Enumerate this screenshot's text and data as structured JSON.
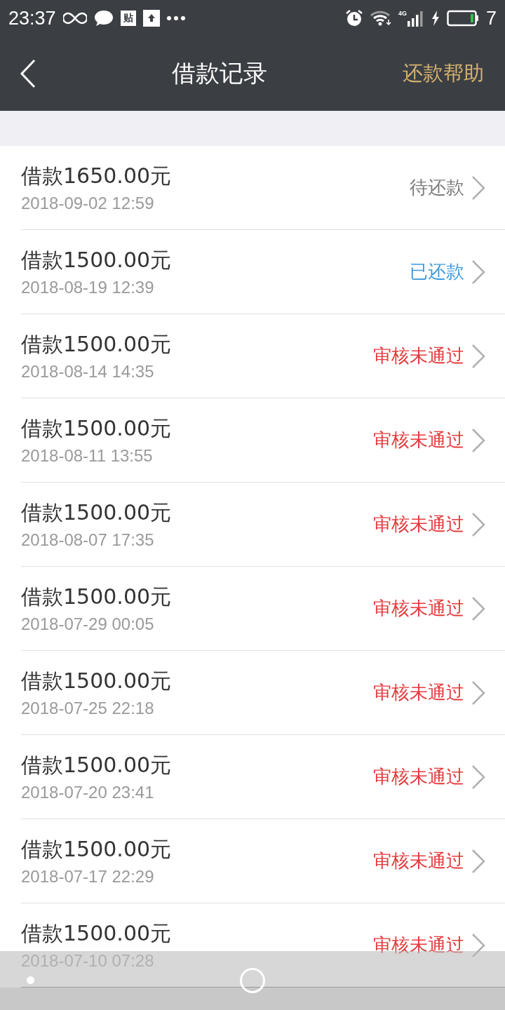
{
  "status_bar": {
    "time": "23:37",
    "notification_badge": "贴",
    "network": "4G",
    "battery": "7"
  },
  "header": {
    "title": "借款记录",
    "action": "还款帮助"
  },
  "records": [
    {
      "title": "借款1650.00元",
      "date": "2018-09-02 12:59",
      "status": "待还款",
      "kind": "pending"
    },
    {
      "title": "借款1500.00元",
      "date": "2018-08-19 12:39",
      "status": "已还款",
      "kind": "repaid"
    },
    {
      "title": "借款1500.00元",
      "date": "2018-08-14 14:35",
      "status": "审核未通过",
      "kind": "rejected"
    },
    {
      "title": "借款1500.00元",
      "date": "2018-08-11 13:55",
      "status": "审核未通过",
      "kind": "rejected"
    },
    {
      "title": "借款1500.00元",
      "date": "2018-08-07 17:35",
      "status": "审核未通过",
      "kind": "rejected"
    },
    {
      "title": "借款1500.00元",
      "date": "2018-07-29 00:05",
      "status": "审核未通过",
      "kind": "rejected"
    },
    {
      "title": "借款1500.00元",
      "date": "2018-07-25 22:18",
      "status": "审核未通过",
      "kind": "rejected"
    },
    {
      "title": "借款1500.00元",
      "date": "2018-07-20 23:41",
      "status": "审核未通过",
      "kind": "rejected"
    },
    {
      "title": "借款1500.00元",
      "date": "2018-07-17 22:29",
      "status": "审核未通过",
      "kind": "rejected"
    },
    {
      "title": "借款1500.00元",
      "date": "2018-07-10 07:28",
      "status": "审核未通过",
      "kind": "rejected"
    }
  ]
}
